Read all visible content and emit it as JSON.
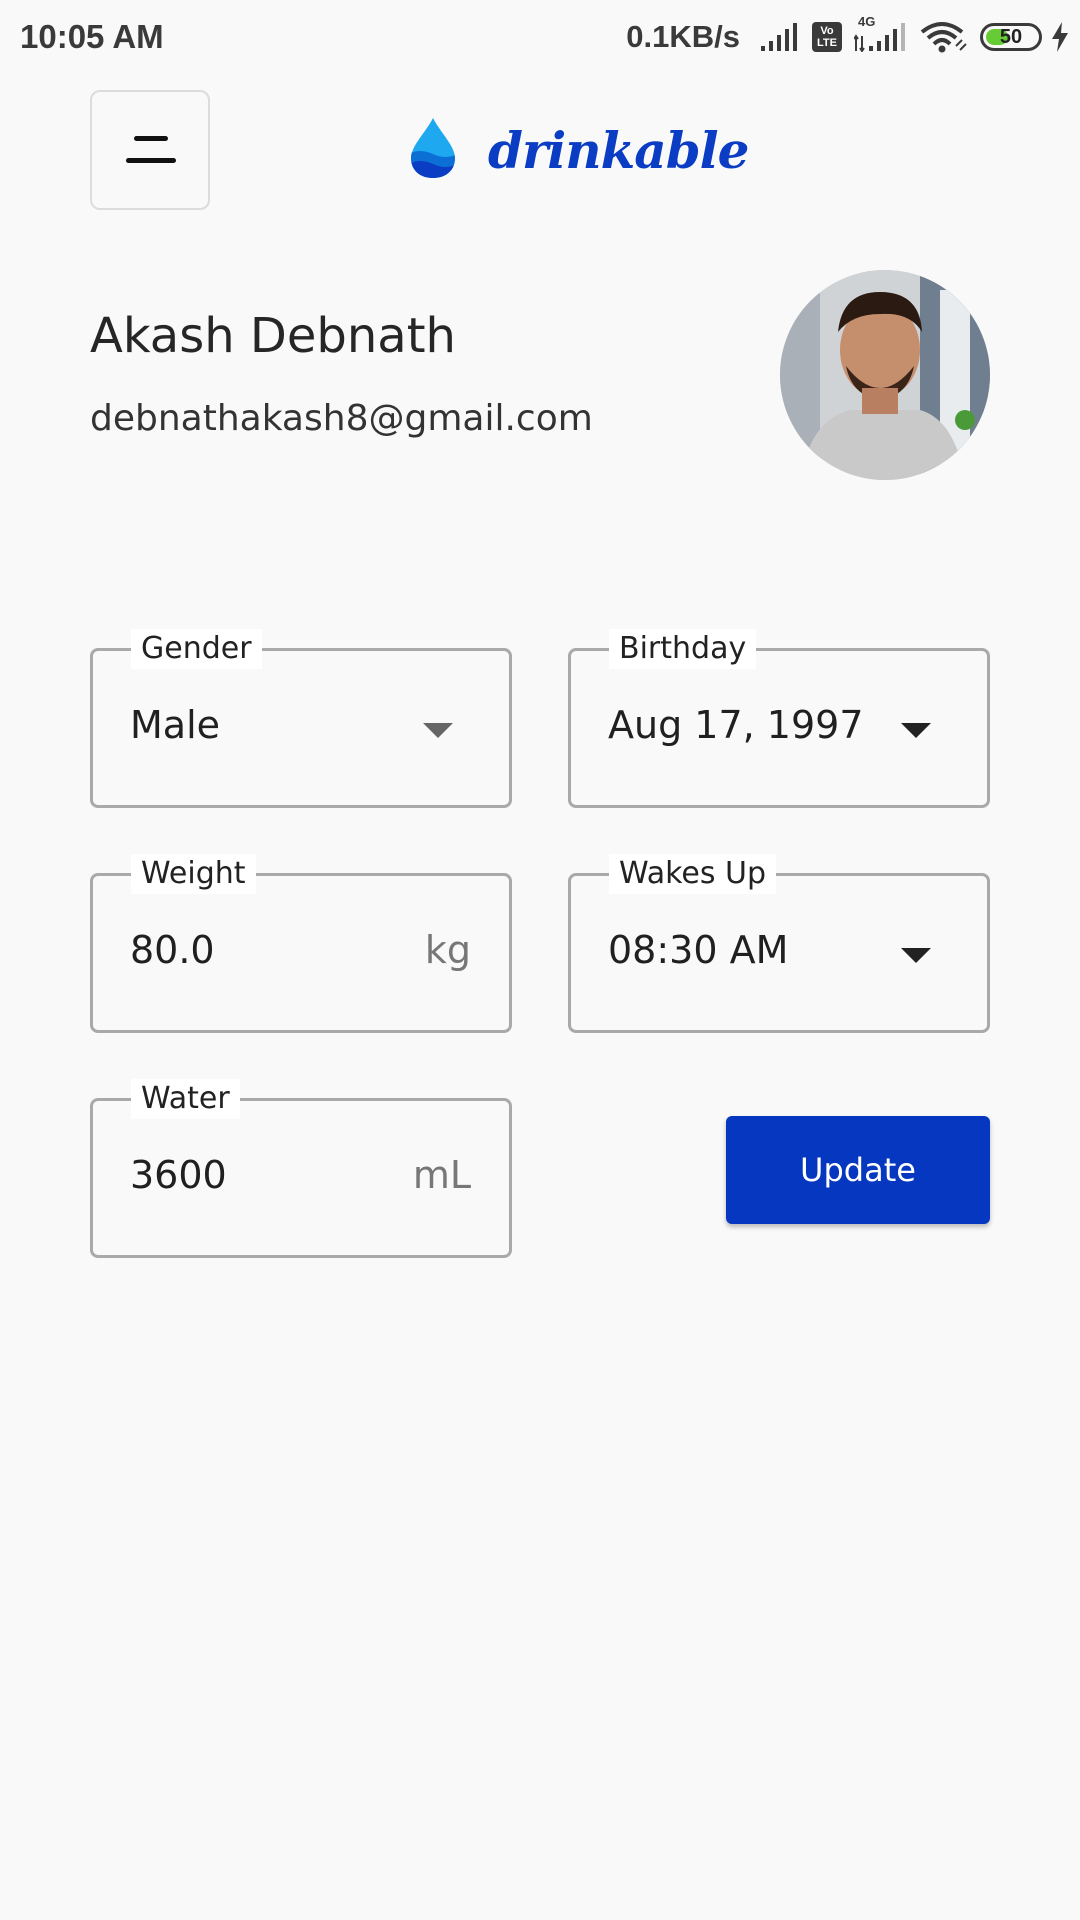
{
  "status_bar": {
    "time": "10:05 AM",
    "net_speed": "0.1KB/s",
    "volte_top": "Vo",
    "volte_bottom": "LTE",
    "network_type": "4G",
    "battery_level": "50",
    "battery_fraction": 0.5,
    "icons": [
      "signal-icon",
      "volte-icon",
      "signal-4g-icon",
      "wifi-icon",
      "battery-icon",
      "charging-icon"
    ]
  },
  "header": {
    "menu_icon": "menu-icon",
    "logo_icon": "water-drop-icon",
    "app_name": "drinkable",
    "brand_color": "#0a3cc4"
  },
  "profile": {
    "name": "Akash Debnath",
    "email": "debnathakash8@gmail.com"
  },
  "form": {
    "gender": {
      "label": "Gender",
      "value": "Male"
    },
    "birthday": {
      "label": "Birthday",
      "value": "Aug 17, 1997"
    },
    "weight": {
      "label": "Weight",
      "value": "80.0",
      "unit": "kg"
    },
    "wakes_up": {
      "label": "Wakes Up",
      "value": "08:30 AM"
    },
    "water": {
      "label": "Water",
      "value": "3600",
      "unit": "mL"
    }
  },
  "actions": {
    "update_label": "Update",
    "accent_color": "#0537c0"
  }
}
